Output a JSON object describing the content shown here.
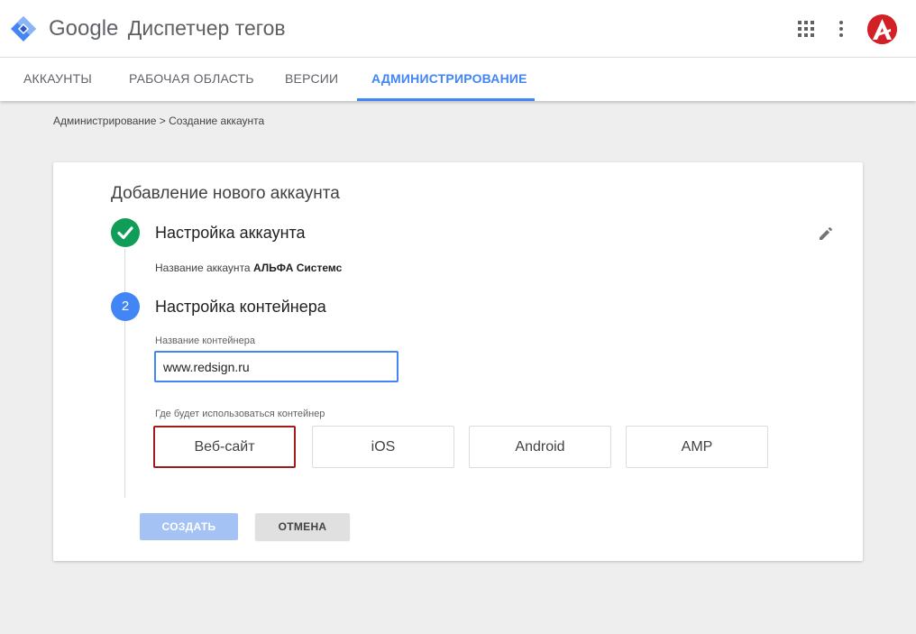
{
  "header": {
    "brand_google": "Google",
    "brand_product": "Диспетчер тегов",
    "icons": {
      "logo": "gtm-diamond-icon",
      "apps": "apps-grid-icon",
      "more": "more-vert-icon",
      "avatar": "avatar"
    },
    "colors": {
      "logo_blue": "#4285f4",
      "logo_dark": "#2a56c6",
      "avatar_red": "#d32027"
    }
  },
  "tabs": [
    {
      "label": "АККАУНТЫ",
      "active": false
    },
    {
      "label": "РАБОЧАЯ ОБЛАСТЬ",
      "active": false
    },
    {
      "label": "ВЕРСИИ",
      "active": false
    },
    {
      "label": "АДМИНИСТРИРОВАНИЕ",
      "active": true
    }
  ],
  "breadcrumb": "Администрирование > Создание аккаунта",
  "card": {
    "title": "Добавление нового аккаунта",
    "step1": {
      "title": "Настройка аккаунта",
      "status": "completed",
      "account_label": "Название аккаунта",
      "account_value": "АЛЬФА Системс"
    },
    "step2": {
      "number": "2",
      "title": "Настройка контейнера",
      "name_label": "Название контейнера",
      "name_value": "www.redsign.ru",
      "usage_label": "Где будет использоваться контейнер",
      "targets": [
        "Веб-сайт",
        "iOS",
        "Android",
        "AMP"
      ],
      "selected_target": "Веб-сайт"
    },
    "buttons": {
      "create": "СОЗДАТЬ",
      "cancel": "ОТМЕНА"
    },
    "colors": {
      "done_green": "#0f9d58",
      "step_blue": "#4285f4",
      "selected_border": "#a01b1b",
      "create_disabled": "#a4c2f4"
    }
  }
}
